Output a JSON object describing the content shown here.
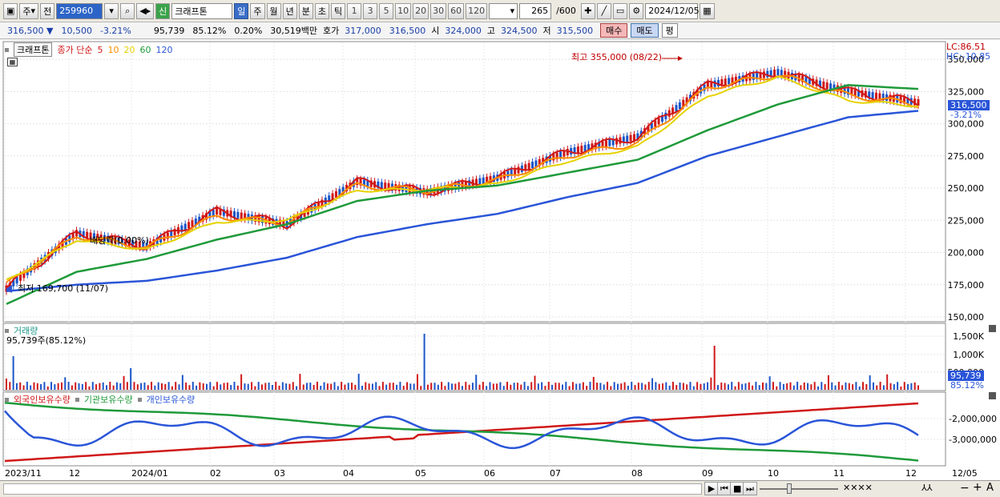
{
  "toolbar": {
    "market": "주",
    "prev_label": "전",
    "code": "259960",
    "badge": "신",
    "stock_name": "크래프톤",
    "periods": [
      "일",
      "주",
      "월",
      "년",
      "분",
      "초",
      "틱"
    ],
    "selected_period": "일",
    "intervals": [
      "1",
      "3",
      "5",
      "10",
      "20",
      "30",
      "60",
      "120"
    ],
    "count": "265",
    "count_max": "/600",
    "date": "2024/12/05"
  },
  "quote": {
    "price": "316,500",
    "change": "10,500",
    "change_pct": "-3.21%",
    "volume": "95,739",
    "volume_ratio": "85.12%",
    "turnover": "0.20%",
    "amount": "30,519백만",
    "ask_label": "호가",
    "ask": "317,000",
    "bid": "316,500",
    "open_label": "시",
    "open": "324,000",
    "high_label": "고",
    "high": "324,500",
    "low_label": "저",
    "low": "315,500",
    "buy_label": "매수",
    "sell_label": "매도",
    "flat_label": "평"
  },
  "price_pane": {
    "stock_label": "크래프톤",
    "ma_title": "종가 단순",
    "ma_periods": [
      "5",
      "10",
      "20",
      "60",
      "120"
    ],
    "ma_colors": [
      "#d01818",
      "#ff8c00",
      "#e6d200",
      "#1f9a3a",
      "#2a55d8"
    ],
    "lc": "LC:86.51",
    "hc": "HC:-10.85",
    "high_annotation": "최고 355,000 (08/22)",
    "low_annotation": "최저 169,700 (11/07)",
    "mid_annotation": "배당락(0.00%)",
    "current_price": "316,500",
    "current_pct": "-3.21%",
    "y_ticks": [
      "350,000",
      "325,000",
      "300,000",
      "275,000",
      "250,000",
      "225,000",
      "200,000",
      "175,000",
      "150,000"
    ]
  },
  "volume_pane": {
    "title": "거래량",
    "info": "95,739주(85.12%)",
    "y_ticks": [
      "1,500K",
      "1,000K",
      "500,000"
    ],
    "current": "95,739",
    "current_pct": "85.12%"
  },
  "holding_pane": {
    "legend": [
      "외국인보유수량",
      "기관보유수량",
      "개인보유수량"
    ],
    "colors": [
      "#d01818",
      "#1f9a3a",
      "#2a55d8"
    ],
    "y_ticks": [
      "-2,000,000",
      "-3,000,000"
    ]
  },
  "x_axis": {
    "labels": [
      "2023/11",
      "12",
      "2024/01",
      "02",
      "03",
      "04",
      "05",
      "06",
      "07",
      "08",
      "09",
      "10",
      "11",
      "12",
      "12/05"
    ]
  },
  "statusbar": {
    "zoom_minus": "−",
    "zoom_plus": "+",
    "font_label": "A"
  },
  "chart_data": {
    "type": "line",
    "x": [
      "2023/11",
      "12",
      "2024/01",
      "02",
      "03",
      "04",
      "05",
      "06",
      "07",
      "08",
      "09",
      "10",
      "11",
      "12"
    ],
    "series": [
      {
        "name": "5",
        "values": [
          172000,
          215000,
          205000,
          232000,
          222000,
          255000,
          247000,
          258000,
          278000,
          290000,
          330000,
          340000,
          325000,
          316500
        ]
      },
      {
        "name": "10",
        "values": [
          175000,
          213000,
          204000,
          228000,
          223000,
          252000,
          248000,
          256000,
          275000,
          285000,
          328000,
          338000,
          322000,
          315000
        ]
      },
      {
        "name": "20",
        "values": [
          178000,
          210000,
          202000,
          224000,
          225000,
          248000,
          249000,
          253000,
          271000,
          282000,
          322000,
          336000,
          318000,
          314000
        ]
      },
      {
        "name": "60",
        "values": [
          160000,
          185000,
          195000,
          210000,
          222000,
          240000,
          248000,
          252000,
          262000,
          272000,
          295000,
          315000,
          330000,
          327000
        ]
      },
      {
        "name": "120",
        "values": [
          170000,
          175000,
          178000,
          186000,
          196000,
          212000,
          222000,
          230000,
          243000,
          254000,
          275000,
          290000,
          305000,
          310000
        ]
      }
    ],
    "ylim": [
      150000,
      360000
    ]
  }
}
